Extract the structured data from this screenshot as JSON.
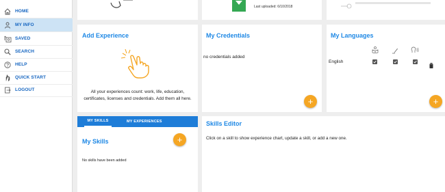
{
  "sidebar": {
    "items": [
      {
        "label": "HOME",
        "icon": "home-icon"
      },
      {
        "label": "MY INFO",
        "icon": "person-icon"
      },
      {
        "label": "SAVED",
        "icon": "saved-icon"
      },
      {
        "label": "SEARCH",
        "icon": "search-icon"
      },
      {
        "label": "HELP",
        "icon": "help-icon"
      },
      {
        "label": "QUICK START",
        "icon": "hand-icon"
      },
      {
        "label": "LOGOUT",
        "icon": "logout-icon"
      }
    ],
    "active_index": 1
  },
  "top_cards": {
    "middle_text": "Last uploaded: 6/10/2018"
  },
  "add_experience": {
    "title": "Add Experience",
    "description": "All your experiences count: work, life, education, certificates, licenses and credentials. Add them all here."
  },
  "credentials": {
    "title": "My Credentials",
    "empty_text": "no credentials added",
    "add_label": "+"
  },
  "languages": {
    "title": "My Languages",
    "rows": [
      {
        "language": "English"
      }
    ],
    "add_label": "+"
  },
  "tabs": {
    "skills": "MY SKILLS",
    "experiences": "MY EXPERIENCES"
  },
  "skills": {
    "title": "My Skills",
    "empty_text": "No skills have been added",
    "add_label": "+"
  },
  "skills_editor": {
    "title": "Skills Editor",
    "instructions": "Click on a skill to show experience chart, update a skill, or add a new one."
  },
  "colors": {
    "accent": "#1e88e5",
    "fab": "#f5a623",
    "active_nav": "#cde3f5",
    "tab_bar": "#1e7dd8",
    "download_green": "#34a853"
  }
}
